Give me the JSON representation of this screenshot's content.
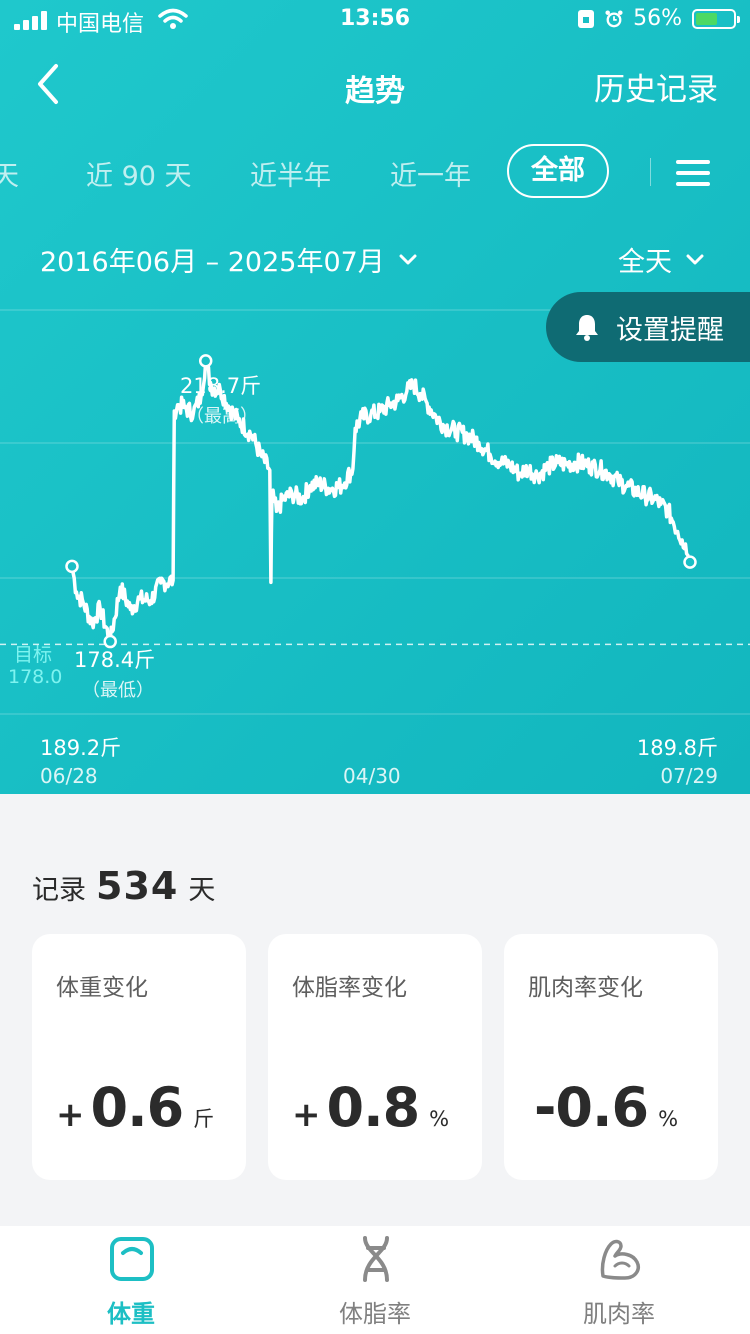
{
  "status_bar": {
    "carrier": "中国电信",
    "time": "13:56",
    "battery": "56%",
    "battery_level": 0.56
  },
  "header": {
    "title": "趋势",
    "history": "历史记录"
  },
  "range_tabs": [
    "天",
    "近 90 天",
    "近半年",
    "近一年",
    "全部"
  ],
  "range_tabs_active": "全部",
  "date_range": "2016年06月 – 2025年07月",
  "day_filter": "全天",
  "reminder": "设置提醒",
  "chart_data": {
    "type": "line",
    "series": [
      {
        "name": "",
        "points": [
          [
            0,
            189.2
          ],
          [
            4,
            185.5
          ],
          [
            10,
            184.0
          ],
          [
            18,
            181.0
          ],
          [
            25,
            183.2
          ],
          [
            34,
            178.4
          ],
          [
            43,
            186.2
          ],
          [
            52,
            183.0
          ],
          [
            60,
            184.5
          ],
          [
            70,
            184.3
          ],
          [
            79,
            186.8
          ],
          [
            90,
            187.2
          ],
          [
            91,
            211.5
          ],
          [
            95,
            212.4
          ],
          [
            100,
            212.0
          ],
          [
            108,
            211.2
          ],
          [
            115,
            213.8
          ],
          [
            119,
            218.7
          ],
          [
            124,
            215.0
          ],
          [
            132,
            214.5
          ],
          [
            140,
            212.0
          ],
          [
            148,
            210.2
          ],
          [
            160,
            208.0
          ],
          [
            168,
            205.2
          ],
          [
            176,
            203.0
          ],
          [
            177,
            186.9
          ],
          [
            178,
            199.7
          ],
          [
            182,
            197.1
          ],
          [
            188,
            198.8
          ],
          [
            196,
            199.6
          ],
          [
            205,
            198.9
          ],
          [
            212,
            200.8
          ],
          [
            220,
            201.1
          ],
          [
            230,
            200.3
          ],
          [
            240,
            200.8
          ],
          [
            250,
            203.2
          ],
          [
            252,
            209.0
          ],
          [
            258,
            210.6
          ],
          [
            266,
            211.0
          ],
          [
            274,
            211.4
          ],
          [
            282,
            212.3
          ],
          [
            290,
            213.0
          ],
          [
            298,
            214.3
          ],
          [
            304,
            215.3
          ],
          [
            310,
            214.0
          ],
          [
            316,
            212.6
          ],
          [
            324,
            210.6
          ],
          [
            332,
            209.3
          ],
          [
            342,
            208.6
          ],
          [
            352,
            208.0
          ],
          [
            362,
            207.0
          ],
          [
            372,
            205.3
          ],
          [
            382,
            204.1
          ],
          [
            390,
            203.7
          ],
          [
            398,
            202.5
          ],
          [
            406,
            203.2
          ],
          [
            414,
            202.2
          ],
          [
            424,
            203.5
          ],
          [
            432,
            204.1
          ],
          [
            440,
            203.8
          ],
          [
            448,
            204.1
          ],
          [
            456,
            203.9
          ],
          [
            464,
            203.5
          ],
          [
            470,
            203.1
          ],
          [
            478,
            202.5
          ],
          [
            486,
            201.4
          ],
          [
            494,
            200.7
          ],
          [
            502,
            200.0
          ],
          [
            510,
            199.4
          ],
          [
            518,
            198.9
          ],
          [
            524,
            198.1
          ],
          [
            530,
            197.4
          ],
          [
            535,
            195.6
          ],
          [
            539,
            194.2
          ],
          [
            543,
            193.0
          ],
          [
            546,
            192.4
          ],
          [
            548,
            190.8
          ],
          [
            550,
            189.8
          ]
        ]
      }
    ],
    "y_range": [
      168,
      226
    ],
    "max_label": "218.7斤",
    "max_note": "（最高）",
    "min_label": "178.4斤",
    "min_note": "（最低）",
    "target_label": "目标",
    "target_value": "178.0",
    "target": 178.0,
    "start_value": "189.2斤",
    "end_value": "189.8斤",
    "x_labels": [
      "06/28",
      "04/30",
      "07/29"
    ],
    "grid": true
  },
  "summary": {
    "record_prefix": "记录",
    "record_days": "534",
    "record_suffix": "天",
    "cards": [
      {
        "label": "体重变化",
        "sign": "+",
        "value": "0.6",
        "unit": "斤"
      },
      {
        "label": "体脂率变化",
        "sign": "+",
        "value": "0.8",
        "unit": "%"
      },
      {
        "label": "肌肉率变化",
        "sign": "",
        "value": "-0.6",
        "unit": "%"
      }
    ]
  },
  "bottom_nav": [
    {
      "label": "体重",
      "icon": "scale-icon",
      "active": true
    },
    {
      "label": "体脂率",
      "icon": "dna-icon",
      "active": false
    },
    {
      "label": "肌肉率",
      "icon": "muscle-icon",
      "active": false
    }
  ],
  "colors": {
    "accent": "#1DBFC4",
    "header_bg": "#19BFC5",
    "reminder_bg": "#0F6B73",
    "battery_fill": "#4CD964"
  }
}
